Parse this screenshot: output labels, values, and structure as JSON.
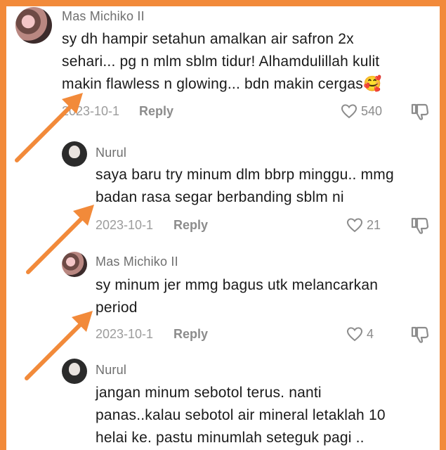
{
  "comments": [
    {
      "author": "Mas Michiko II",
      "lines": [
        "sy dh hampir setahun amalkan air safron 2x",
        "sehari... pg n mlm sblm tidur! Alhamdulillah kulit",
        "makin flawless n glowing... bdn makin cergas🥰"
      ],
      "date": "2023-10-1",
      "reply": "Reply",
      "likes": "540"
    },
    {
      "author": "Nurul",
      "lines": [
        "saya baru try minum dlm bbrp minggu.. mmg",
        "badan rasa segar berbanding sblm ni"
      ],
      "date": "2023-10-1",
      "reply": "Reply",
      "likes": "21"
    },
    {
      "author": "Mas Michiko II",
      "lines": [
        "sy minum jer mmg bagus utk melancarkan",
        "period"
      ],
      "date": "2023-10-1",
      "reply": "Reply",
      "likes": "4"
    },
    {
      "author": "Nurul",
      "lines": [
        "jangan minum sebotol terus. nanti",
        "panas..kalau sebotol air mineral letaklah 10",
        "helai ke. pastu minumlah seteguk pagi .."
      ]
    }
  ],
  "colors": {
    "frame": "#f28a3a",
    "arrow": "#f28a3a"
  },
  "icons": {
    "like": "heart-outline-icon",
    "dislike": "thumbs-down-icon"
  }
}
